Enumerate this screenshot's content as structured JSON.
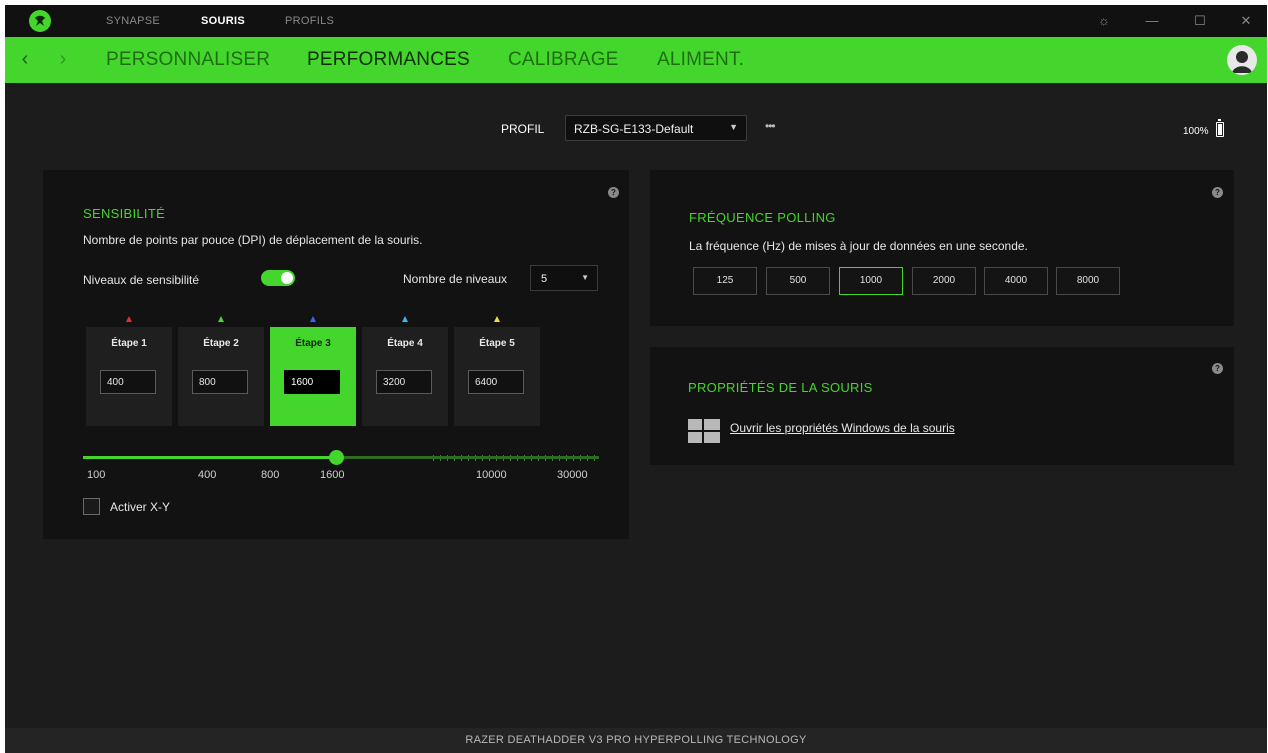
{
  "titlebar": {
    "tabs": [
      "SYNAPSE",
      "SOURIS",
      "PROFILS"
    ],
    "active_tab": "SOURIS",
    "icons": [
      "razer-logo-icon",
      "settings-icon",
      "minimize-icon",
      "maximize-icon",
      "close-icon"
    ]
  },
  "nav": {
    "tabs": [
      "PERSONNALISER",
      "PERFORMANCES",
      "CALIBRAGE",
      "ALIMENT."
    ],
    "active_tab": "PERFORMANCES"
  },
  "profile": {
    "label": "PROFIL",
    "value": "RZB-SG-E133-Default",
    "more": "•••"
  },
  "battery": {
    "level": "100%"
  },
  "sensitivity": {
    "title": "SENSIBILITÉ",
    "description": "Nombre de points par pouce (DPI) de déplacement de la souris.",
    "toggle_label": "Niveaux de sensibilité",
    "toggle_on": true,
    "levels_label": "Nombre de niveaux",
    "levels_value": "5",
    "stages": [
      {
        "label": "Étape 1",
        "value": "400",
        "color": "#e03030"
      },
      {
        "label": "Étape 2",
        "value": "800",
        "color": "#44d62c"
      },
      {
        "label": "Étape 3",
        "value": "1600",
        "color": "#2f6cf0"
      },
      {
        "label": "Étape 4",
        "value": "3200",
        "color": "#30b8e8"
      },
      {
        "label": "Étape 5",
        "value": "6400",
        "color": "#e8e040"
      }
    ],
    "active_stage": 3,
    "slider_scale": [
      "100",
      "400",
      "800",
      "1600",
      "10000",
      "30000"
    ],
    "slider_value": 1600,
    "xy_label": "Activer X-Y",
    "xy_checked": false
  },
  "polling": {
    "title": "FRÉQUENCE POLLING",
    "description": "La fréquence (Hz) de mises à jour de données en une seconde.",
    "options": [
      "125",
      "500",
      "1000",
      "2000",
      "4000",
      "8000"
    ],
    "selected": "1000"
  },
  "mouse_props": {
    "title": "PROPRIÉTÉS DE LA SOURIS",
    "link": "Ouvrir les propriétés Windows de la souris"
  },
  "footer": {
    "device": "RAZER DEATHADDER V3 PRO HYPERPOLLING TECHNOLOGY"
  },
  "colors": {
    "accent": "#44d62c",
    "panel": "#121212",
    "background": "#1c1c1c"
  }
}
